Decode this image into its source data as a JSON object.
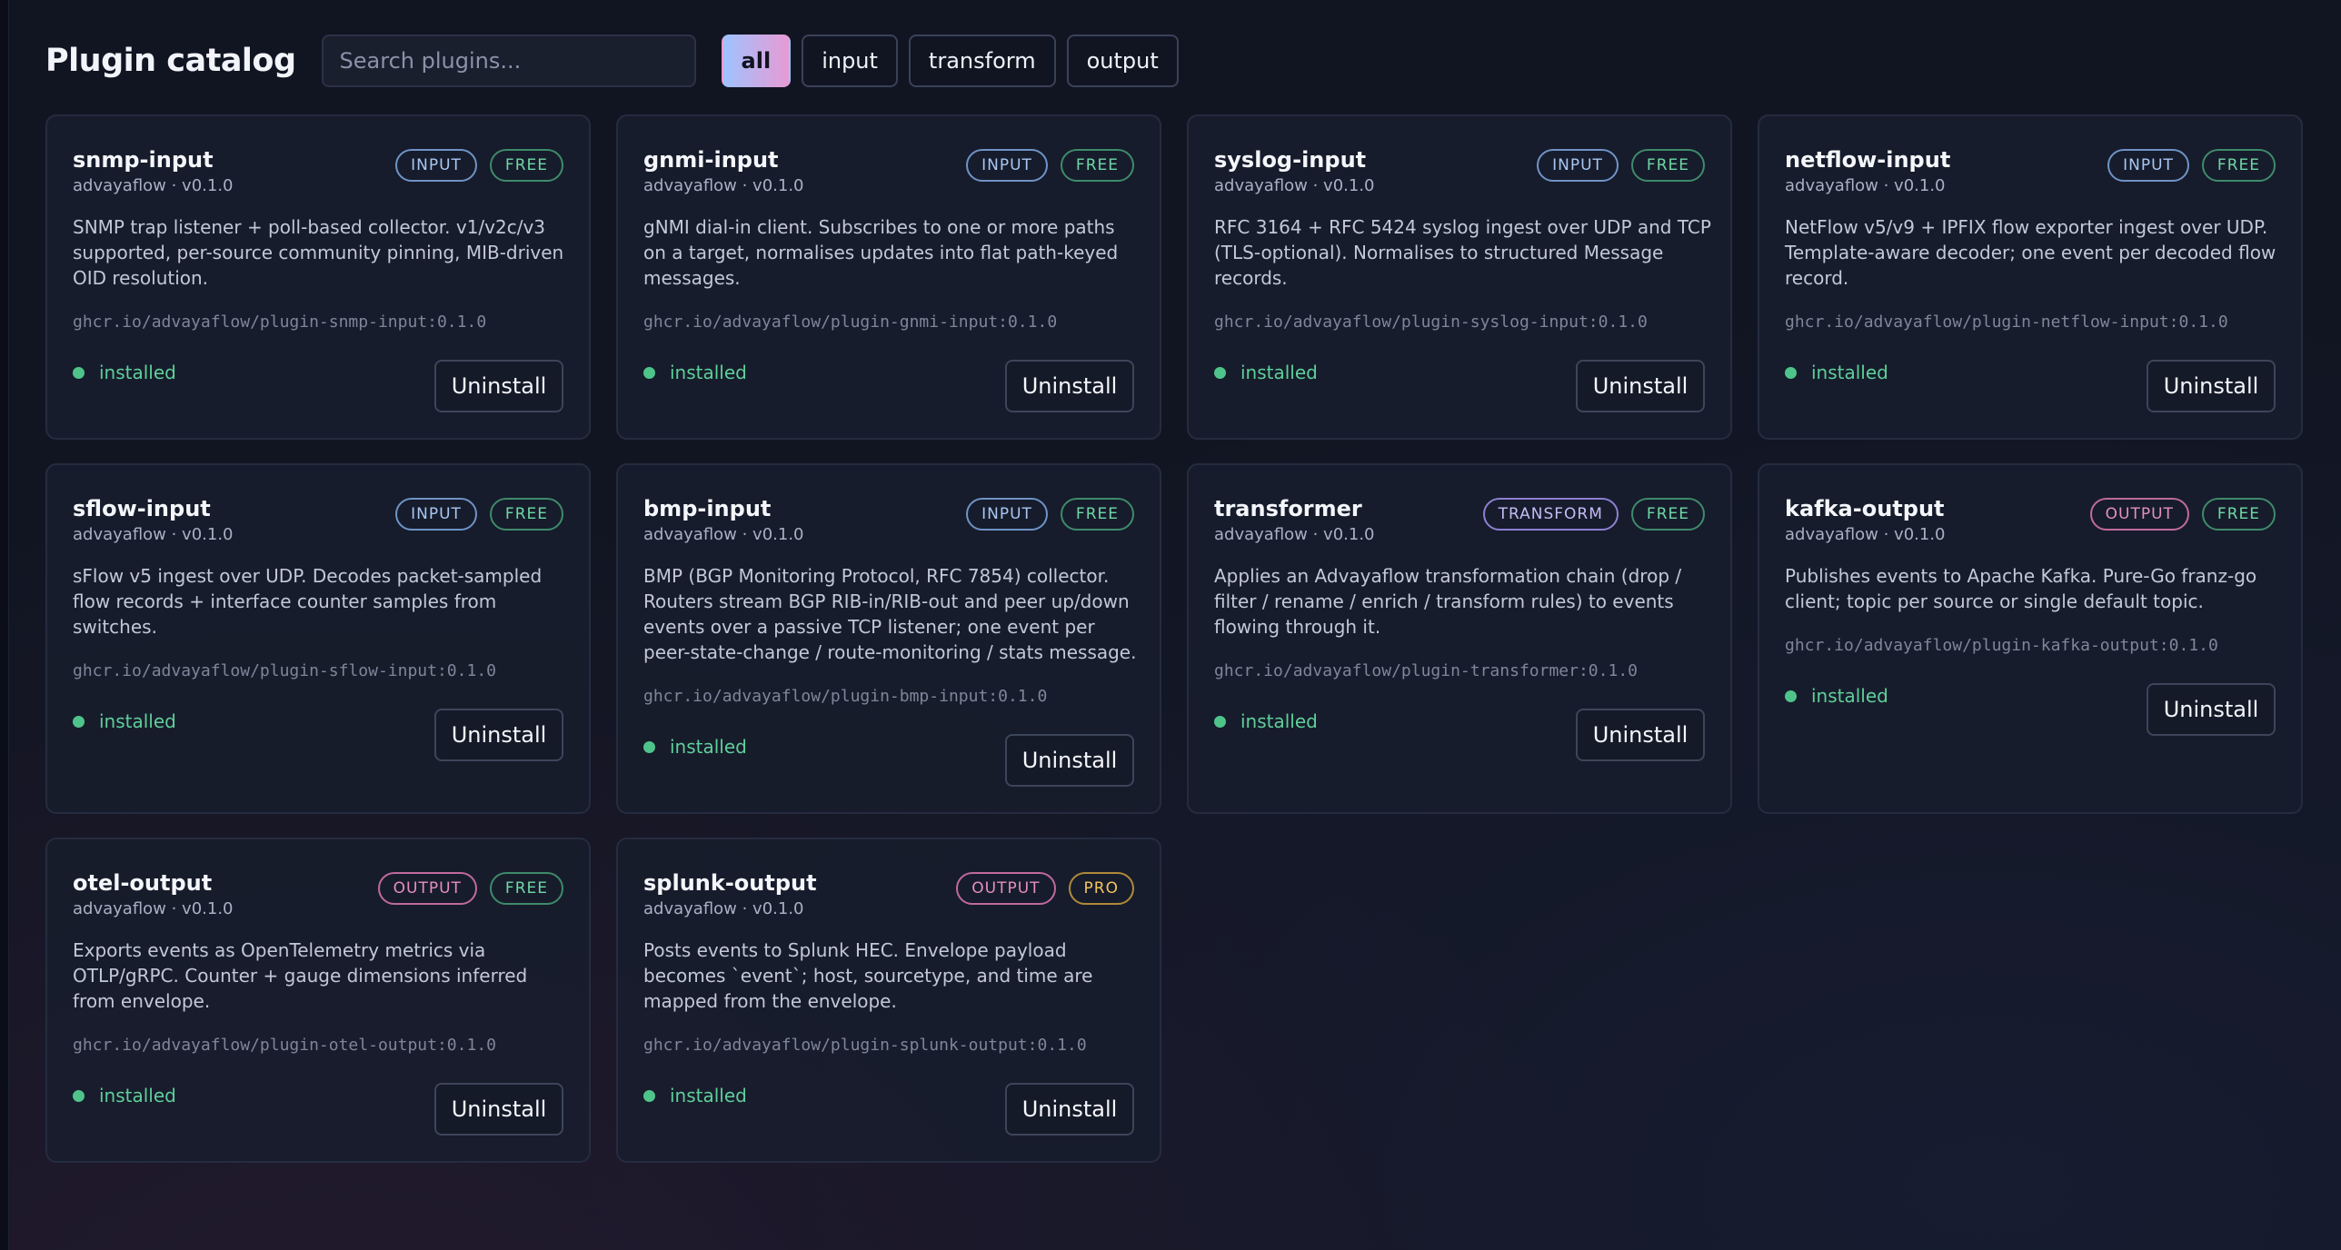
{
  "header": {
    "title": "Plugin catalog",
    "search_placeholder": "Search plugins...",
    "filters": [
      "all",
      "input",
      "transform",
      "output"
    ],
    "active_filter": "all"
  },
  "plugins": [
    {
      "name": "snmp-input",
      "meta": "advayaflow · v0.1.0",
      "kind": "INPUT",
      "tier": "FREE",
      "description": "SNMP trap listener + poll-based collector. v1/v2c/v3 supported, per-source community pinning, MIB-driven OID resolution.",
      "image": "ghcr.io/advayaflow/plugin-snmp-input:0.1.0",
      "status": "installed",
      "action": "Uninstall"
    },
    {
      "name": "gnmi-input",
      "meta": "advayaflow · v0.1.0",
      "kind": "INPUT",
      "tier": "FREE",
      "description": "gNMI dial-in client. Subscribes to one or more paths on a target, normalises updates into flat path-keyed messages.",
      "image": "ghcr.io/advayaflow/plugin-gnmi-input:0.1.0",
      "status": "installed",
      "action": "Uninstall"
    },
    {
      "name": "syslog-input",
      "meta": "advayaflow · v0.1.0",
      "kind": "INPUT",
      "tier": "FREE",
      "description": "RFC 3164 + RFC 5424 syslog ingest over UDP and TCP (TLS-optional). Normalises to structured Message records.",
      "image": "ghcr.io/advayaflow/plugin-syslog-input:0.1.0",
      "status": "installed",
      "action": "Uninstall"
    },
    {
      "name": "netflow-input",
      "meta": "advayaflow · v0.1.0",
      "kind": "INPUT",
      "tier": "FREE",
      "description": "NetFlow v5/v9 + IPFIX flow exporter ingest over UDP. Template-aware decoder; one event per decoded flow record.",
      "image": "ghcr.io/advayaflow/plugin-netflow-input:0.1.0",
      "status": "installed",
      "action": "Uninstall"
    },
    {
      "name": "sflow-input",
      "meta": "advayaflow · v0.1.0",
      "kind": "INPUT",
      "tier": "FREE",
      "description": "sFlow v5 ingest over UDP. Decodes packet-sampled flow records + interface counter samples from switches.",
      "image": "ghcr.io/advayaflow/plugin-sflow-input:0.1.0",
      "status": "installed",
      "action": "Uninstall"
    },
    {
      "name": "bmp-input",
      "meta": "advayaflow · v0.1.0",
      "kind": "INPUT",
      "tier": "FREE",
      "description": "BMP (BGP Monitoring Protocol, RFC 7854) collector. Routers stream BGP RIB-in/RIB-out and peer up/down events over a passive TCP listener; one event per peer-state-change / route-monitoring / stats message.",
      "image": "ghcr.io/advayaflow/plugin-bmp-input:0.1.0",
      "status": "installed",
      "action": "Uninstall"
    },
    {
      "name": "transformer",
      "meta": "advayaflow · v0.1.0",
      "kind": "TRANSFORM",
      "tier": "FREE",
      "description": "Applies an Advayaflow transformation chain (drop / filter / rename / enrich / transform rules) to events flowing through it.",
      "image": "ghcr.io/advayaflow/plugin-transformer:0.1.0",
      "status": "installed",
      "action": "Uninstall"
    },
    {
      "name": "kafka-output",
      "meta": "advayaflow · v0.1.0",
      "kind": "OUTPUT",
      "tier": "FREE",
      "description": "Publishes events to Apache Kafka. Pure-Go franz-go client; topic per source or single default topic.",
      "image": "ghcr.io/advayaflow/plugin-kafka-output:0.1.0",
      "status": "installed",
      "action": "Uninstall"
    },
    {
      "name": "otel-output",
      "meta": "advayaflow · v0.1.0",
      "kind": "OUTPUT",
      "tier": "FREE",
      "description": "Exports events as OpenTelemetry metrics via OTLP/gRPC. Counter + gauge dimensions inferred from envelope.",
      "image": "ghcr.io/advayaflow/plugin-otel-output:0.1.0",
      "status": "installed",
      "action": "Uninstall"
    },
    {
      "name": "splunk-output",
      "meta": "advayaflow · v0.1.0",
      "kind": "OUTPUT",
      "tier": "PRO",
      "description": "Posts events to Splunk HEC. Envelope payload becomes `event`; host, sourcetype, and time are mapped from the envelope.",
      "image": "ghcr.io/advayaflow/plugin-splunk-output:0.1.0",
      "status": "installed",
      "action": "Uninstall"
    }
  ],
  "colors": {
    "installed": "#4fc48a",
    "free": "#6fd6a4",
    "pro": "#f2c45c",
    "input": "#a9c7f3",
    "transform": "#c5bbf5",
    "output": "#e58fc0"
  }
}
